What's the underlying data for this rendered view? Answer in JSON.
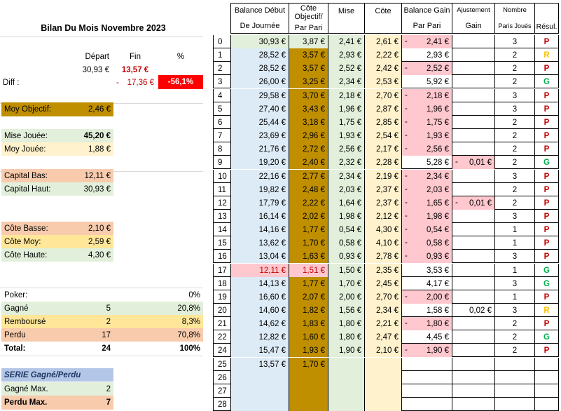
{
  "title": "Bilan Du Mois Novembre 2023",
  "summary": {
    "depart_label": "Départ",
    "fin_label": "Fin",
    "pct_label": "%",
    "depart_value": "30,93 €",
    "fin_value": "13,57 €",
    "diff_label": "Diff :",
    "diff_sign": "-",
    "diff_value": "17,36 €",
    "diff_pct": "-56,1%",
    "moy_objectif_label": "Moy Objectif:",
    "moy_objectif_value": "2,46 €",
    "mise_jouee_label": "Mise Jouée:",
    "mise_jouee_value": "45,20 €",
    "moy_jouee_label": "Moy Jouée:",
    "moy_jouee_value": "1,88 €",
    "capital_bas_label": "Capital Bas:",
    "capital_bas_value": "12,11 €",
    "capital_haut_label": "Capital Haut:",
    "capital_haut_value": "30,93 €",
    "cote_basse_label": "Côte Basse:",
    "cote_basse_value": "2,10 €",
    "cote_moy_label": "Côte Moy:",
    "cote_moy_value": "2,59 €",
    "cote_haute_label": "Côte Haute:",
    "cote_haute_value": "4,30 €",
    "poker_label": "Poker:",
    "poker_pct": "0%",
    "gagne_label": "Gagné",
    "gagne_count": "5",
    "gagne_pct": "20,8%",
    "rembourse_label": "Remboursé",
    "rembourse_count": "2",
    "rembourse_pct": "8,3%",
    "perdu_label": "Perdu",
    "perdu_count": "17",
    "perdu_pct": "70,8%",
    "total_label": "Total:",
    "total_count": "24",
    "total_pct": "100%",
    "serie_label": "SERIE Gagné/Perdu",
    "gagne_max_label": "Gagné Max.",
    "gagne_max_value": "2",
    "perdu_max_label": "Perdu Max.",
    "perdu_max_value": "7"
  },
  "table": {
    "headers": {
      "balance_debut": [
        "Balance Début",
        "De Journée"
      ],
      "objectif": [
        "Côte Objectif/",
        "Par Pari"
      ],
      "mise": "Mise",
      "cote": "Côte",
      "balance_gain": [
        "Balance Gain",
        "Par Pari"
      ],
      "ajustement": [
        "Ajustement",
        "Gain"
      ],
      "nombre": [
        "Nombre",
        "Paris Joués"
      ],
      "result": "Résul."
    },
    "rows": [
      {
        "n": "0",
        "bal": "30,93 €",
        "obj": "3,87 €",
        "mise": "2,41 €",
        "cote": "2,61 €",
        "gneg": "-",
        "gain": "2,41 €",
        "aneg": "",
        "adj": "",
        "nb": "3",
        "res": "P"
      },
      {
        "n": "1",
        "bal": "28,52 €",
        "obj": "3,57 €",
        "mise": "2,93 €",
        "cote": "2,22 €",
        "gneg": "",
        "gain": "2,93 €",
        "aneg": "",
        "adj": "",
        "nb": "2",
        "res": "R"
      },
      {
        "n": "2",
        "bal": "28,52 €",
        "obj": "3,57 €",
        "mise": "2,52 €",
        "cote": "2,42 €",
        "gneg": "-",
        "gain": "2,52 €",
        "aneg": "",
        "adj": "",
        "nb": "2",
        "res": "P"
      },
      {
        "n": "3",
        "bal": "26,00 €",
        "obj": "3,25 €",
        "mise": "2,34 €",
        "cote": "2,53 €",
        "gneg": "",
        "gain": "5,92 €",
        "aneg": "",
        "adj": "",
        "nb": "2",
        "res": "G"
      },
      {
        "n": "4",
        "bal": "29,58 €",
        "obj": "3,70 €",
        "mise": "2,18 €",
        "cote": "2,70 €",
        "gneg": "-",
        "gain": "2,18 €",
        "aneg": "",
        "adj": "",
        "nb": "3",
        "res": "P"
      },
      {
        "n": "5",
        "bal": "27,40 €",
        "obj": "3,43 €",
        "mise": "1,96 €",
        "cote": "2,87 €",
        "gneg": "-",
        "gain": "1,96 €",
        "aneg": "",
        "adj": "",
        "nb": "3",
        "res": "P"
      },
      {
        "n": "6",
        "bal": "25,44 €",
        "obj": "3,18 €",
        "mise": "1,75 €",
        "cote": "2,85 €",
        "gneg": "-",
        "gain": "1,75 €",
        "aneg": "",
        "adj": "",
        "nb": "2",
        "res": "P"
      },
      {
        "n": "7",
        "bal": "23,69 €",
        "obj": "2,96 €",
        "mise": "1,93 €",
        "cote": "2,54 €",
        "gneg": "-",
        "gain": "1,93 €",
        "aneg": "",
        "adj": "",
        "nb": "2",
        "res": "P"
      },
      {
        "n": "8",
        "bal": "21,76 €",
        "obj": "2,72 €",
        "mise": "2,56 €",
        "cote": "2,17 €",
        "gneg": "-",
        "gain": "2,56 €",
        "aneg": "",
        "adj": "",
        "nb": "2",
        "res": "P"
      },
      {
        "n": "9",
        "bal": "19,20 €",
        "obj": "2,40 €",
        "mise": "2,32 €",
        "cote": "2,28 €",
        "gneg": "",
        "gain": "5,28 €",
        "aneg": "-",
        "adj": "0,01 €",
        "nb": "2",
        "res": "G"
      },
      {
        "n": "10",
        "bal": "22,16 €",
        "obj": "2,77 €",
        "mise": "2,34 €",
        "cote": "2,19 €",
        "gneg": "-",
        "gain": "2,34 €",
        "aneg": "",
        "adj": "",
        "nb": "3",
        "res": "P"
      },
      {
        "n": "11",
        "bal": "19,82 €",
        "obj": "2,48 €",
        "mise": "2,03 €",
        "cote": "2,37 €",
        "gneg": "-",
        "gain": "2,03 €",
        "aneg": "",
        "adj": "",
        "nb": "2",
        "res": "P"
      },
      {
        "n": "12",
        "bal": "17,79 €",
        "obj": "2,22 €",
        "mise": "1,64 €",
        "cote": "2,37 €",
        "gneg": "-",
        "gain": "1,65 €",
        "aneg": "-",
        "adj": "0,01 €",
        "nb": "2",
        "res": "P"
      },
      {
        "n": "13",
        "bal": "16,14 €",
        "obj": "2,02 €",
        "mise": "1,98 €",
        "cote": "2,12 €",
        "gneg": "-",
        "gain": "1,98 €",
        "aneg": "",
        "adj": "",
        "nb": "3",
        "res": "P"
      },
      {
        "n": "14",
        "bal": "14,16 €",
        "obj": "1,77 €",
        "mise": "0,54 €",
        "cote": "4,30 €",
        "gneg": "-",
        "gain": "0,54 €",
        "aneg": "",
        "adj": "",
        "nb": "1",
        "res": "P"
      },
      {
        "n": "15",
        "bal": "13,62 €",
        "obj": "1,70 €",
        "mise": "0,58 €",
        "cote": "4,10 €",
        "gneg": "-",
        "gain": "0,58 €",
        "aneg": "",
        "adj": "",
        "nb": "1",
        "res": "P"
      },
      {
        "n": "16",
        "bal": "13,04 €",
        "obj": "1,63 €",
        "mise": "0,93 €",
        "cote": "2,78 €",
        "gneg": "-",
        "gain": "0,93 €",
        "aneg": "",
        "adj": "",
        "nb": "3",
        "res": "P"
      },
      {
        "n": "17",
        "bal": "12,11 €",
        "obj": "1,51 €",
        "mise": "1,50 €",
        "cote": "2,35 €",
        "gneg": "",
        "gain": "3,53 €",
        "aneg": "",
        "adj": "",
        "nb": "1",
        "res": "G"
      },
      {
        "n": "18",
        "bal": "14,13 €",
        "obj": "1,77 €",
        "mise": "1,70 €",
        "cote": "2,45 €",
        "gneg": "",
        "gain": "4,17 €",
        "aneg": "",
        "adj": "",
        "nb": "3",
        "res": "G"
      },
      {
        "n": "19",
        "bal": "16,60 €",
        "obj": "2,07 €",
        "mise": "2,00 €",
        "cote": "2,70 €",
        "gneg": "-",
        "gain": "2,00 €",
        "aneg": "",
        "adj": "",
        "nb": "1",
        "res": "P"
      },
      {
        "n": "20",
        "bal": "14,60 €",
        "obj": "1,82 €",
        "mise": "1,56 €",
        "cote": "2,34 €",
        "gneg": "",
        "gain": "1,58 €",
        "aneg": "",
        "adj": "0,02 €",
        "nb": "3",
        "res": "R"
      },
      {
        "n": "21",
        "bal": "14,62 €",
        "obj": "1,83 €",
        "mise": "1,80 €",
        "cote": "2,21 €",
        "gneg": "-",
        "gain": "1,80 €",
        "aneg": "",
        "adj": "",
        "nb": "2",
        "res": "P"
      },
      {
        "n": "22",
        "bal": "12,82 €",
        "obj": "1,60 €",
        "mise": "1,80 €",
        "cote": "2,47 €",
        "gneg": "",
        "gain": "4,45 €",
        "aneg": "",
        "adj": "",
        "nb": "2",
        "res": "G"
      },
      {
        "n": "24",
        "bal": "15,47 €",
        "obj": "1,93 €",
        "mise": "1,90 €",
        "cote": "2,10 €",
        "gneg": "-",
        "gain": "1,90 €",
        "aneg": "",
        "adj": "",
        "nb": "2",
        "res": "P"
      },
      {
        "n": "25",
        "bal": "13,57 €",
        "obj": "1,70 €",
        "mise": "",
        "cote": "",
        "gneg": "",
        "gain": "",
        "aneg": "",
        "adj": "",
        "nb": "",
        "res": ""
      },
      {
        "n": "26",
        "bal": "",
        "obj": "",
        "mise": "",
        "cote": "",
        "gneg": "",
        "gain": "",
        "aneg": "",
        "adj": "",
        "nb": "",
        "res": ""
      },
      {
        "n": "27",
        "bal": "",
        "obj": "",
        "mise": "",
        "cote": "",
        "gneg": "",
        "gain": "",
        "aneg": "",
        "adj": "",
        "nb": "",
        "res": ""
      },
      {
        "n": "28",
        "bal": "",
        "obj": "",
        "mise": "",
        "cote": "",
        "gneg": "",
        "gain": "",
        "aneg": "",
        "adj": "",
        "nb": "",
        "res": ""
      }
    ]
  },
  "colors": {
    "gold": "#bf8f00",
    "green_light": "#e2efda",
    "red_light": "#f8cbad",
    "pink": "#ffc7ce",
    "yellow_light": "#fff2cc",
    "blue_light": "#ddebf7",
    "red_strong": "#ff0000",
    "result_p": "#c00000",
    "result_r": "#ffc000",
    "result_g": "#00b050",
    "serie_bg": "#b4c6e7",
    "serie_text": "#1f3864"
  }
}
